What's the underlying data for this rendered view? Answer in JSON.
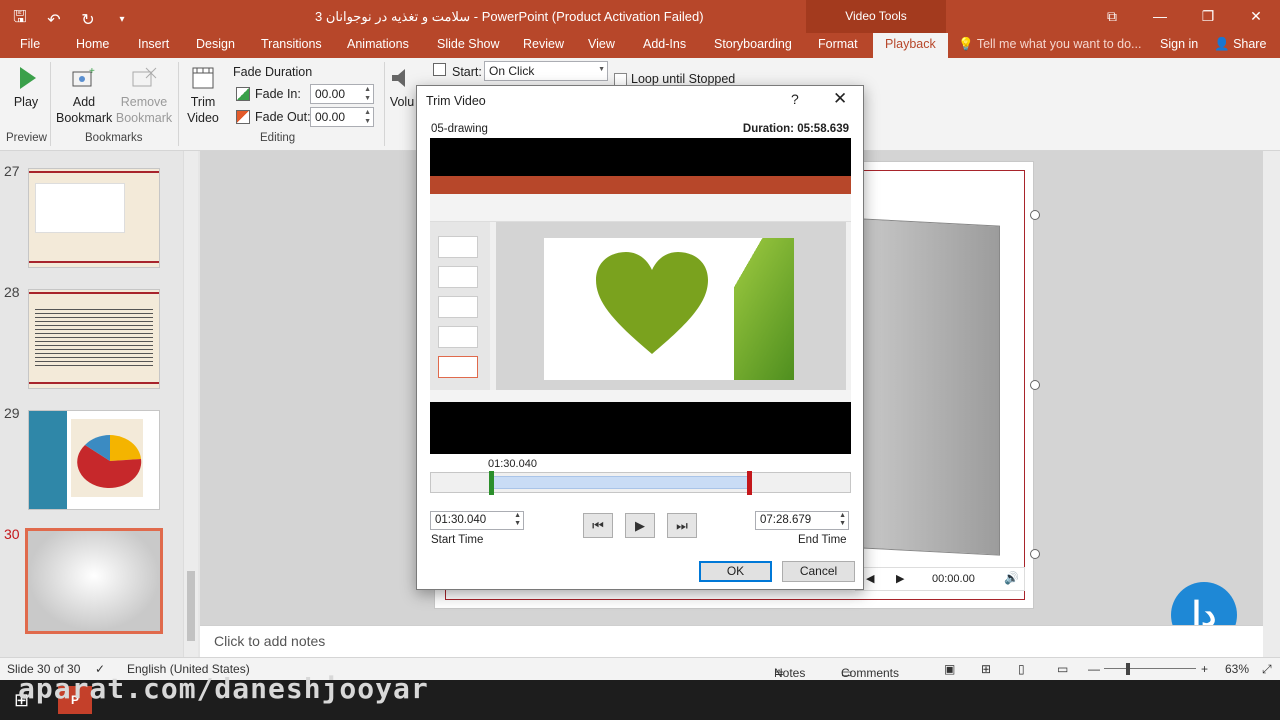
{
  "titlebar": {
    "title": "3 سلامت و تغذیه در نوجوانان - PowerPoint (Product Activation Failed)",
    "context_tab": "Video Tools",
    "quick_access": [
      "save-icon",
      "undo-icon",
      "redo-icon",
      "customize-icon"
    ]
  },
  "tabs": {
    "items": [
      "File",
      "Home",
      "Insert",
      "Design",
      "Transitions",
      "Animations",
      "Slide Show",
      "Review",
      "View",
      "Add-Ins",
      "Storyboarding",
      "Format",
      "Playback"
    ],
    "active": "Playback",
    "tell_me": "Tell me what you want to do...",
    "sign_in": "Sign in",
    "share": "Share"
  },
  "ribbon": {
    "play": "Play",
    "add_bookmark_1": "Add",
    "add_bookmark_2": "Bookmark",
    "remove_bookmark_1": "Remove",
    "remove_bookmark_2": "Bookmark",
    "trim_1": "Trim",
    "trim_2": "Video",
    "fade_duration": "Fade Duration",
    "fade_in": "Fade In:",
    "fade_in_value": "00.00",
    "fade_out": "Fade Out:",
    "fade_out_value": "00.00",
    "volume": "Volu",
    "start": "Start:",
    "start_value": "On Click",
    "loop": "Loop until Stopped",
    "groups": {
      "preview": "Preview",
      "bookmarks": "Bookmarks",
      "editing": "Editing"
    }
  },
  "slides": {
    "numbers": [
      "27",
      "28",
      "29",
      "30"
    ],
    "selected": "30"
  },
  "notes": {
    "placeholder": "Click to add notes"
  },
  "player": {
    "time": "00:00.00"
  },
  "status": {
    "slide": "Slide 30 of 30",
    "language": "English (United States)",
    "notes": "Notes",
    "comments": "Comments",
    "zoom": "63%"
  },
  "watermark": "aparat.com/daneshjooyar",
  "dialog": {
    "title": "Trim Video",
    "help": "?",
    "close": "✕",
    "file_name": "05-drawing",
    "duration": "Duration: 05:58.639",
    "current_time": "01:30.040",
    "start_time": "01:30.040",
    "end_time": "07:28.679",
    "start_label": "Start Time",
    "end_label": "End Time",
    "ok": "OK",
    "cancel": "Cancel",
    "selection_start_fraction": 0.14,
    "selection_end_fraction": 0.75
  },
  "colors": {
    "accent": "#b7472a",
    "start_marker": "#2b8f2b",
    "end_marker": "#c4171b"
  }
}
